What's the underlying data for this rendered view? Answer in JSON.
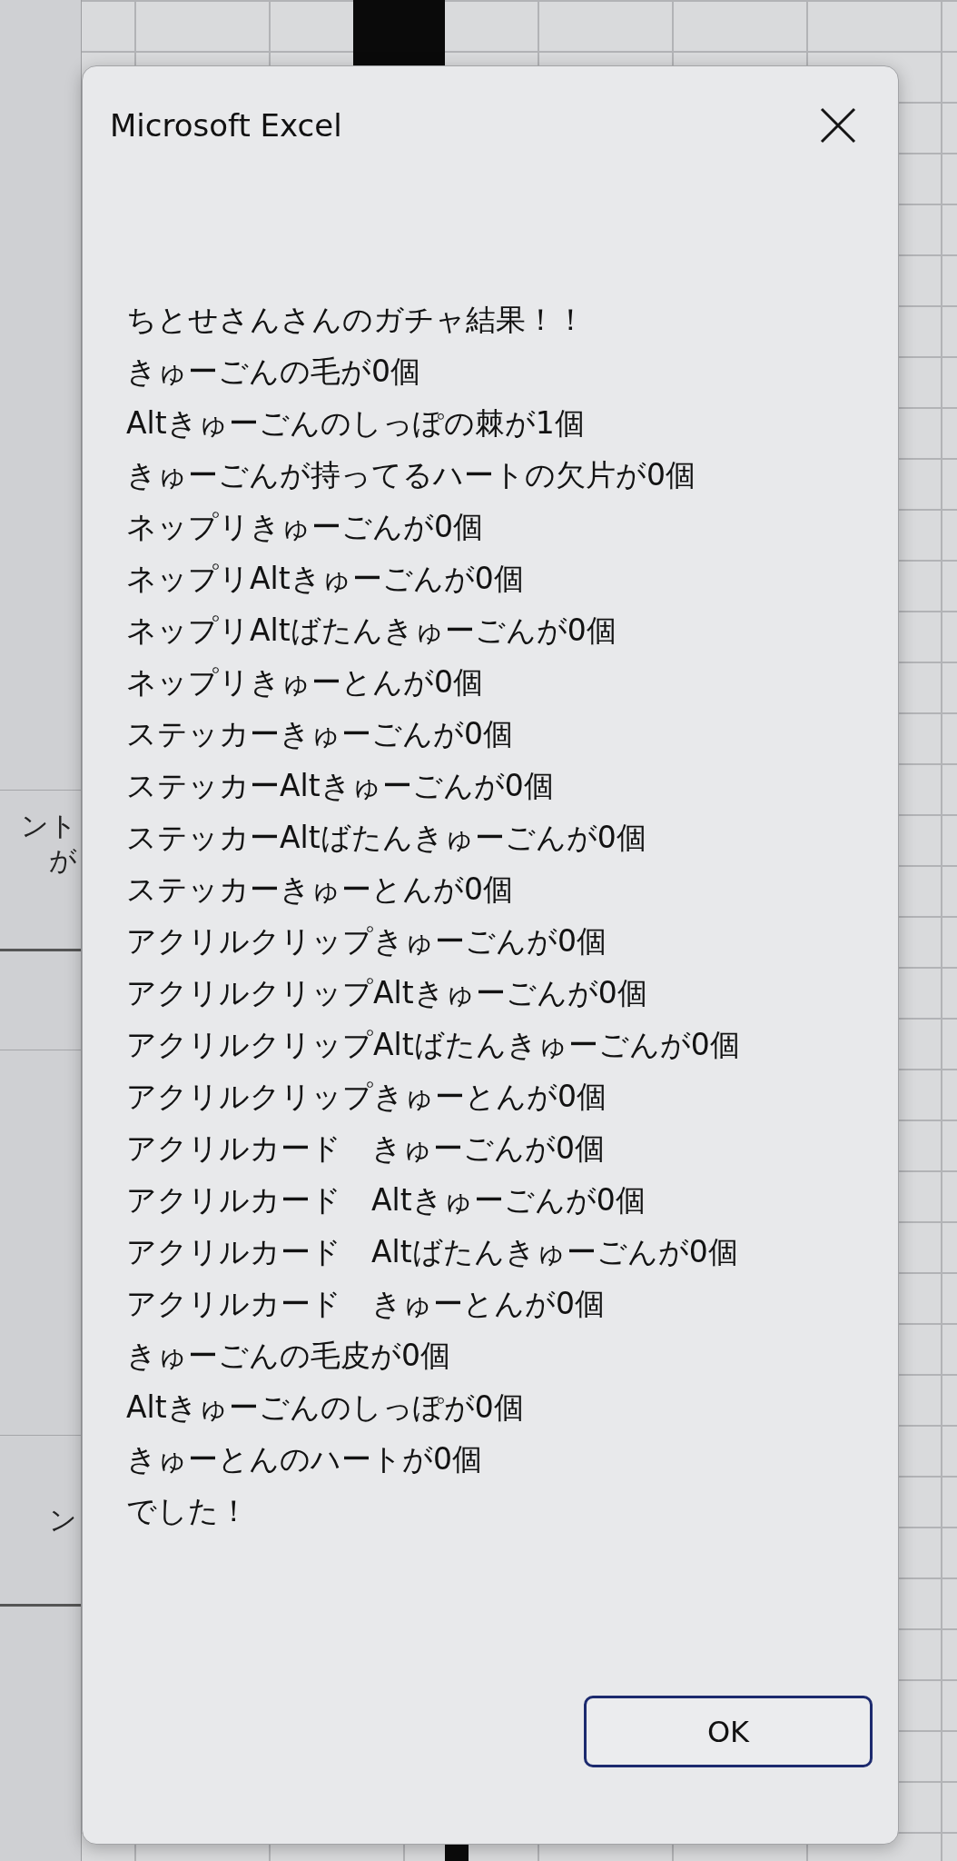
{
  "background": {
    "cell_fragments": [
      "ント",
      "が",
      "ン"
    ]
  },
  "dialog": {
    "title": "Microsoft Excel",
    "message_lines": [
      "ちとせさんさんのガチャ結果！！",
      "きゅーごんの毛が0個",
      "Altきゅーごんのしっぽの棘が1個",
      "きゅーごんが持ってるハートの欠片が0個",
      "ネップリきゅーごんが0個",
      "ネップリAltきゅーごんが0個",
      "ネップリAltばたんきゅーごんが0個",
      "ネップリきゅーとんが0個",
      "ステッカーきゅーごんが0個",
      "ステッカーAltきゅーごんが0個",
      "ステッカーAltばたんきゅーごんが0個",
      "ステッカーきゅーとんが0個",
      "アクリルクリップきゅーごんが0個",
      "アクリルクリップAltきゅーごんが0個",
      "アクリルクリップAltばたんきゅーごんが0個",
      "アクリルクリップきゅーとんが0個",
      "アクリルカード　きゅーごんが0個",
      "アクリルカード　Altきゅーごんが0個",
      "アクリルカード　Altばたんきゅーごんが0個",
      "アクリルカード　きゅーとんが0個",
      "きゅーごんの毛皮が0個",
      "Altきゅーごんのしっぽが0個",
      "きゅーとんのハートが0個",
      "でした！"
    ],
    "buttons": [
      {
        "label": "OK",
        "default": true
      }
    ]
  }
}
